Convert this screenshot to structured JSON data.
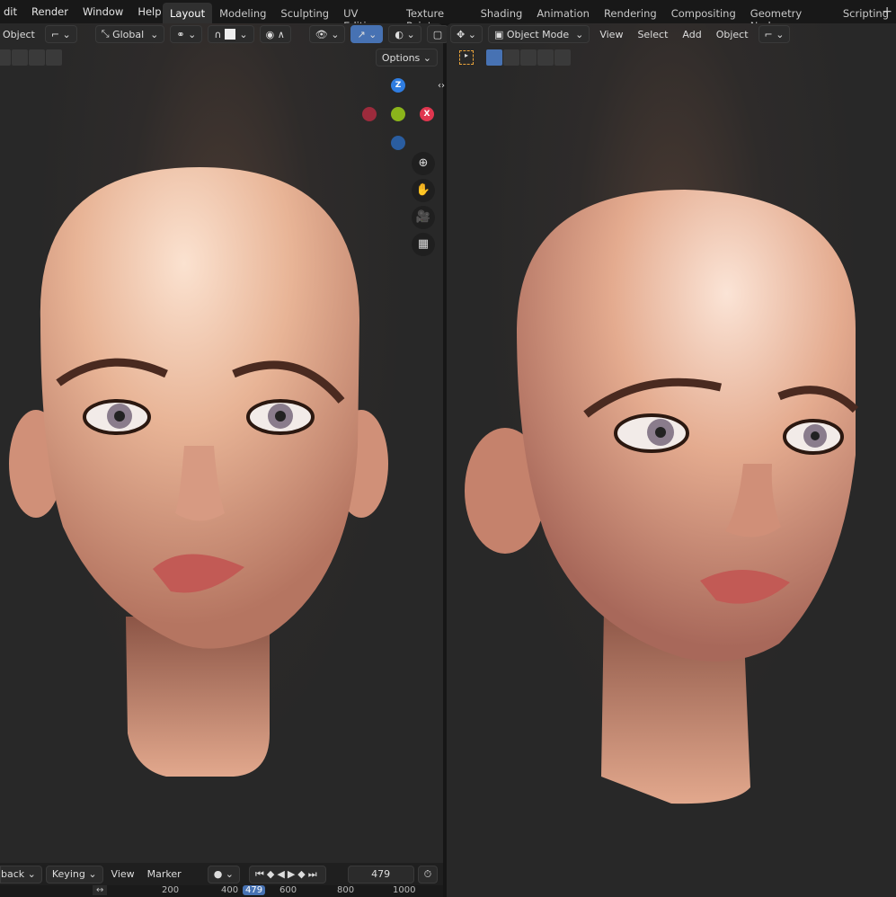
{
  "menu": [
    "dit",
    "Render",
    "Window",
    "Help"
  ],
  "tabs": [
    "Layout",
    "Modeling",
    "Sculpting",
    "UV Editing",
    "Texture Paint",
    "Shading",
    "Animation",
    "Rendering",
    "Compositing",
    "Geometry Nodes",
    "Scripting"
  ],
  "active_tab": "Layout",
  "left_header": {
    "mode": "Object",
    "orientation": "Global",
    "options": "Options"
  },
  "right_header": {
    "mode": "Object Mode",
    "view": "View",
    "select": "Select",
    "add": "Add",
    "object": "Object"
  },
  "gizmo": {
    "z": "Z",
    "x": "X"
  },
  "timeline": {
    "playback": "back",
    "keying": "Keying",
    "view": "View",
    "marker": "Marker",
    "frame": "479",
    "ruler": [
      "200",
      "400",
      "479",
      "600",
      "800",
      "1000"
    ]
  },
  "colors": {
    "accent": "#4772b3",
    "x_axis": "#e0364f",
    "y_axis": "#8bb41b",
    "z_axis": "#2f7de1"
  }
}
